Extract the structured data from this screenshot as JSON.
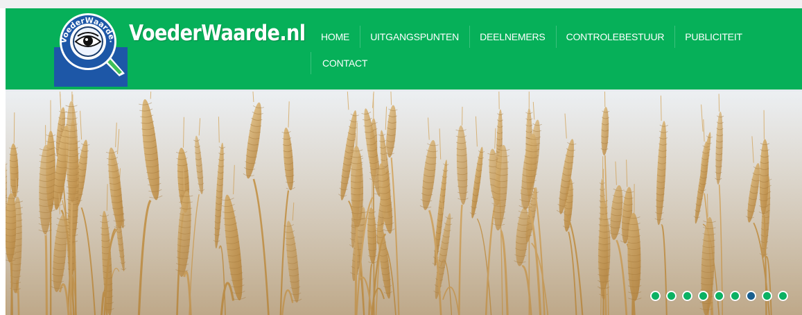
{
  "site": {
    "brand_name": "VoederWaarde.nl",
    "logo_ring_text": "VoederWaarde.nl"
  },
  "colors": {
    "header_green": "#06b059",
    "nav_text": "#ffffff",
    "logo_blue": "#1d57a7",
    "dot_active": "#1a5f8f",
    "dot_inactive": "#0bb163"
  },
  "nav": {
    "items": [
      {
        "label": "HOME"
      },
      {
        "label": "UITGANGSPUNTEN"
      },
      {
        "label": "DEELNEMERS"
      },
      {
        "label": "CONTROLEBESTUUR"
      },
      {
        "label": "PUBLICITEIT"
      },
      {
        "label": "CONTACT"
      }
    ]
  },
  "slider": {
    "image": "wheat-field-photo",
    "slide_count": 9,
    "active_slide": 7
  },
  "icons": {
    "logo": "magnifying-glass-eye-logo"
  }
}
